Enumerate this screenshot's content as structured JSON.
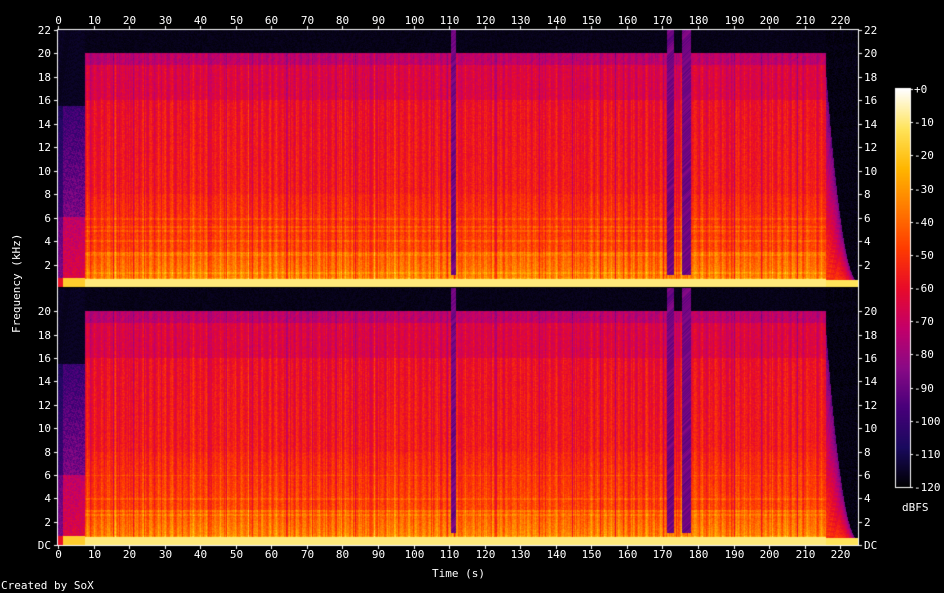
{
  "chart_data": {
    "type": "heatmap",
    "title": "",
    "xlabel": "Time (s)",
    "ylabel": "Frequency (kHz)",
    "xlim": [
      0,
      225
    ],
    "ylim_khz": [
      0,
      22
    ],
    "x_ticks": [
      0,
      10,
      20,
      30,
      40,
      50,
      60,
      70,
      80,
      90,
      100,
      110,
      120,
      130,
      140,
      150,
      160,
      170,
      180,
      190,
      200,
      210,
      220
    ],
    "y_tick_labels_top": [
      "2",
      "4",
      "6",
      "8",
      "10",
      "12",
      "14",
      "16",
      "18",
      "20",
      "22"
    ],
    "y_tick_labels_bottom": [
      "DC",
      "2",
      "4",
      "6",
      "8",
      "10",
      "12",
      "14",
      "16",
      "18",
      "20"
    ],
    "channels": 2,
    "colorbar": {
      "unit": "dBFS",
      "ticks": [
        "+0",
        "-10",
        "-20",
        "-30",
        "-40",
        "-50",
        "-60",
        "-70",
        "-80",
        "-90",
        "-100",
        "-110",
        "-120"
      ],
      "range": [
        -120,
        0
      ],
      "colors": [
        "#000000",
        "#1a0a5e",
        "#48007a",
        "#8a0a86",
        "#c4006a",
        "#e80b2a",
        "#ff3c00",
        "#ff7a00",
        "#ffb600",
        "#ffe45a",
        "#ffffff"
      ]
    },
    "audio_start_s": 7.5,
    "content_end_s": 216,
    "lowpass_khz": 20,
    "intro_cutoff_khz": 15.5,
    "dips_s": [
      {
        "start": 110.5,
        "end": 112.0
      },
      {
        "start": 171.3,
        "end": 173.2
      },
      {
        "start": 175.5,
        "end": 178.0
      }
    ]
  },
  "footer": {
    "credit": "Created by SoX"
  }
}
